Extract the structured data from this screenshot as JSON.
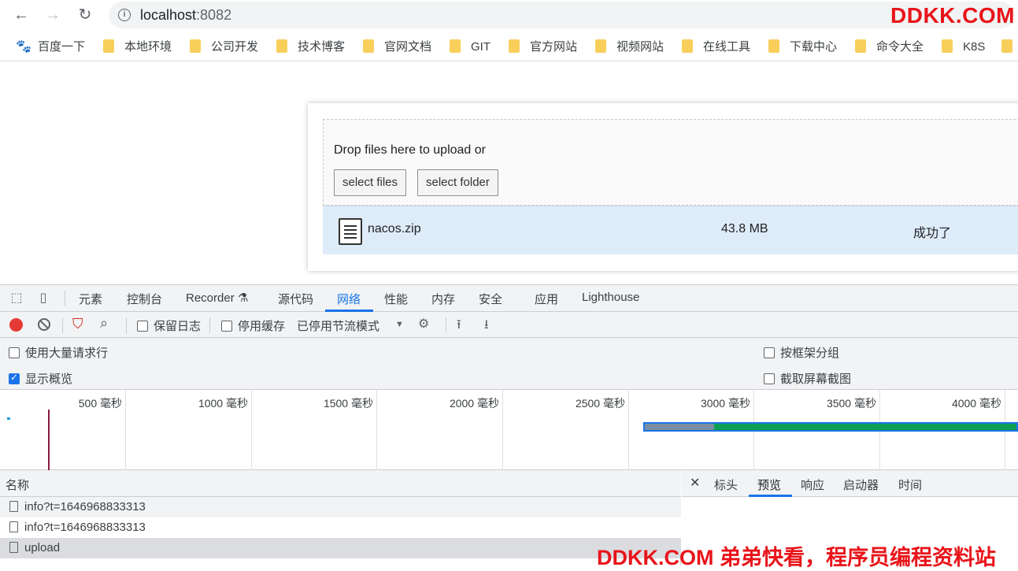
{
  "browser": {
    "url_host": "localhost",
    "url_port": ":8082",
    "brand": "DDKK.COM"
  },
  "bookmarks": [
    {
      "label": "百度一下",
      "icon": "paw-icon"
    },
    {
      "label": "本地环境",
      "icon": "folder-icon"
    },
    {
      "label": "公司开发",
      "icon": "folder-icon"
    },
    {
      "label": "技术博客",
      "icon": "folder-icon"
    },
    {
      "label": "官网文档",
      "icon": "folder-icon"
    },
    {
      "label": "GIT",
      "icon": "folder-icon"
    },
    {
      "label": "官方网站",
      "icon": "folder-icon"
    },
    {
      "label": "视频网站",
      "icon": "folder-icon"
    },
    {
      "label": "在线工具",
      "icon": "folder-icon"
    },
    {
      "label": "下载中心",
      "icon": "folder-icon"
    },
    {
      "label": "命令大全",
      "icon": "folder-icon"
    },
    {
      "label": "K8S",
      "icon": "folder-icon"
    }
  ],
  "uploader": {
    "drop_text": "Drop files here to upload or",
    "select_files": "select files",
    "select_folder": "select folder",
    "file": {
      "name": "nacos.zip",
      "size": "43.8 MB",
      "status": "成功了"
    }
  },
  "devtools": {
    "tabs": [
      "元素",
      "控制台",
      "Recorder ⚗",
      "源代码",
      "网络",
      "性能",
      "内存",
      "安全",
      "应用",
      "Lighthouse"
    ],
    "active_tab": "网络",
    "toolbar": {
      "preserve_log": "保留日志",
      "disable_cache": "停用缓存",
      "throttling": "已停用节流模式"
    },
    "options": {
      "large_rows": "使用大量请求行",
      "group_by_frame": "按框架分组",
      "show_overview": "显示概览",
      "capture_screenshots": "截取屏幕截图"
    },
    "timeline_labels": [
      "500 毫秒",
      "1000 毫秒",
      "1500 毫秒",
      "2000 毫秒",
      "2500 毫秒",
      "3000 毫秒",
      "3500 毫秒",
      "4000 毫秒"
    ],
    "names_header": "名称",
    "requests": [
      "info?t=1646968833313",
      "info?t=1646968833313",
      "upload"
    ],
    "detail_tabs": [
      "标头",
      "预览",
      "响应",
      "启动器",
      "时间"
    ],
    "active_detail_tab": "预览"
  },
  "watermark": "DDKK.COM 弟弟快看，程序员编程资料站"
}
